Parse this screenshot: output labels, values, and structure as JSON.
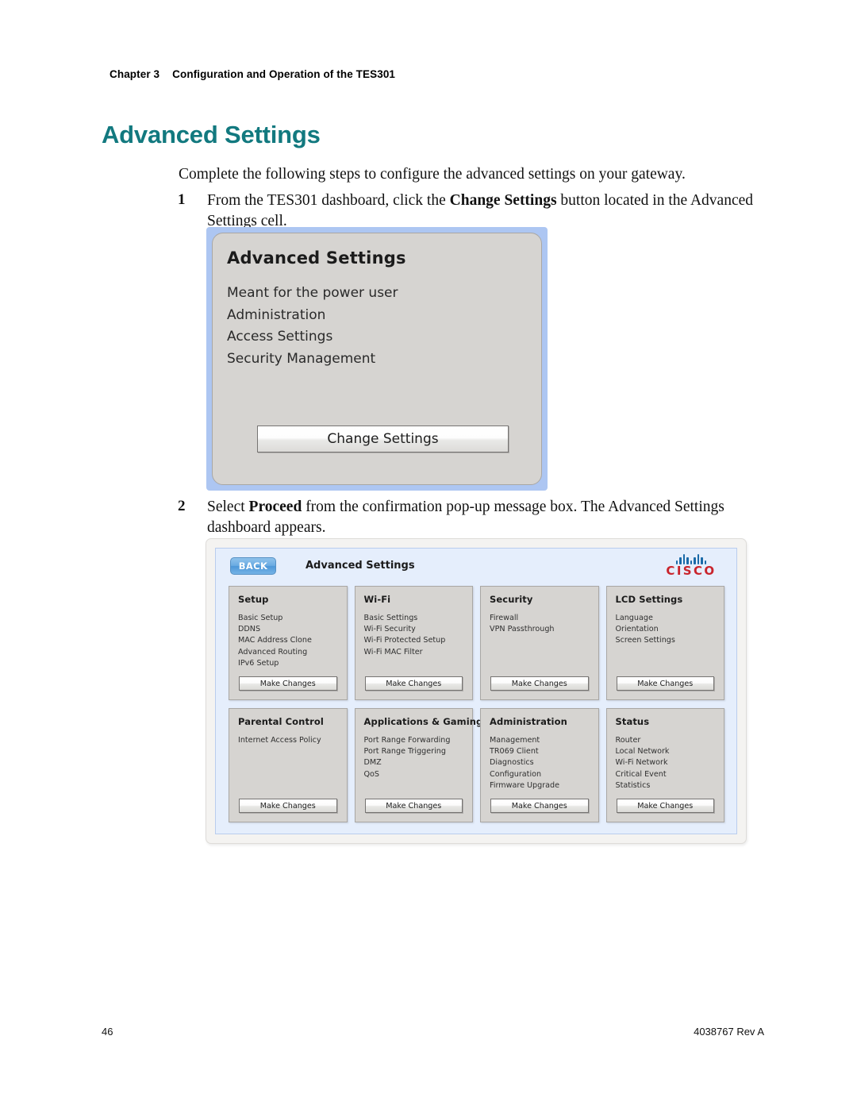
{
  "running_head": {
    "chapter": "Chapter 3",
    "title": "Configuration and Operation of the TES301"
  },
  "heading": "Advanced Settings",
  "heading_color": "#12797f",
  "intro": "Complete the following steps to configure the advanced settings on your gateway.",
  "steps": [
    {
      "number": "1",
      "text_before": "From the TES301 dashboard, click the ",
      "bold": "Change Settings",
      "text_after": " button located in the Advanced Settings cell."
    },
    {
      "number": "2",
      "text_before": "Select ",
      "bold": "Proceed",
      "text_after": " from the confirmation pop-up message box. The Advanced Settings dashboard appears."
    }
  ],
  "figure_cell": {
    "title": "Advanced Settings",
    "lines": [
      "Meant for the power user",
      "Administration",
      "Access Settings",
      "Security Management"
    ],
    "button_label": "Change Settings",
    "frame_color": "#adc6f2"
  },
  "figure_dashboard": {
    "back_label": "BACK",
    "title": "Advanced Settings",
    "logo": {
      "wordmark": "CISCO",
      "bar_color": "#1a6aa8",
      "word_color": "#c9242c"
    },
    "make_changes_label": "Make Changes",
    "cards": [
      {
        "title": "Setup",
        "items": [
          "Basic Setup",
          "DDNS",
          "MAC Address Clone",
          "Advanced Routing",
          "IPv6 Setup"
        ],
        "button": "Make Changes"
      },
      {
        "title": "Wi-Fi",
        "items": [
          "Basic Settings",
          "Wi-Fi Security",
          "Wi-Fi Protected Setup",
          "Wi-Fi MAC Filter"
        ],
        "button": "Make Changes"
      },
      {
        "title": "Security",
        "items": [
          "Firewall",
          "VPN Passthrough"
        ],
        "button": "Make Changes"
      },
      {
        "title": "LCD Settings",
        "items": [
          "Language",
          "Orientation",
          "Screen Settings"
        ],
        "button": "Make Changes"
      },
      {
        "title": "Parental Control",
        "items": [
          "Internet Access Policy"
        ],
        "button": "Make Changes"
      },
      {
        "title": "Applications & Gaming",
        "items": [
          "Port Range Forwarding",
          "Port Range Triggering",
          "DMZ",
          "QoS"
        ],
        "button": "Make Changes"
      },
      {
        "title": "Administration",
        "items": [
          "Management",
          "TR069 Client",
          "Diagnostics",
          "Configuration",
          "Firmware Upgrade"
        ],
        "button": "Make Changes"
      },
      {
        "title": "Status",
        "items": [
          "Router",
          "Local Network",
          "Wi-Fi Network",
          "Critical Event",
          "Statistics"
        ],
        "button": "Make Changes"
      }
    ]
  },
  "footer": {
    "page_number": "46",
    "doc_id": "4038767 Rev A"
  }
}
